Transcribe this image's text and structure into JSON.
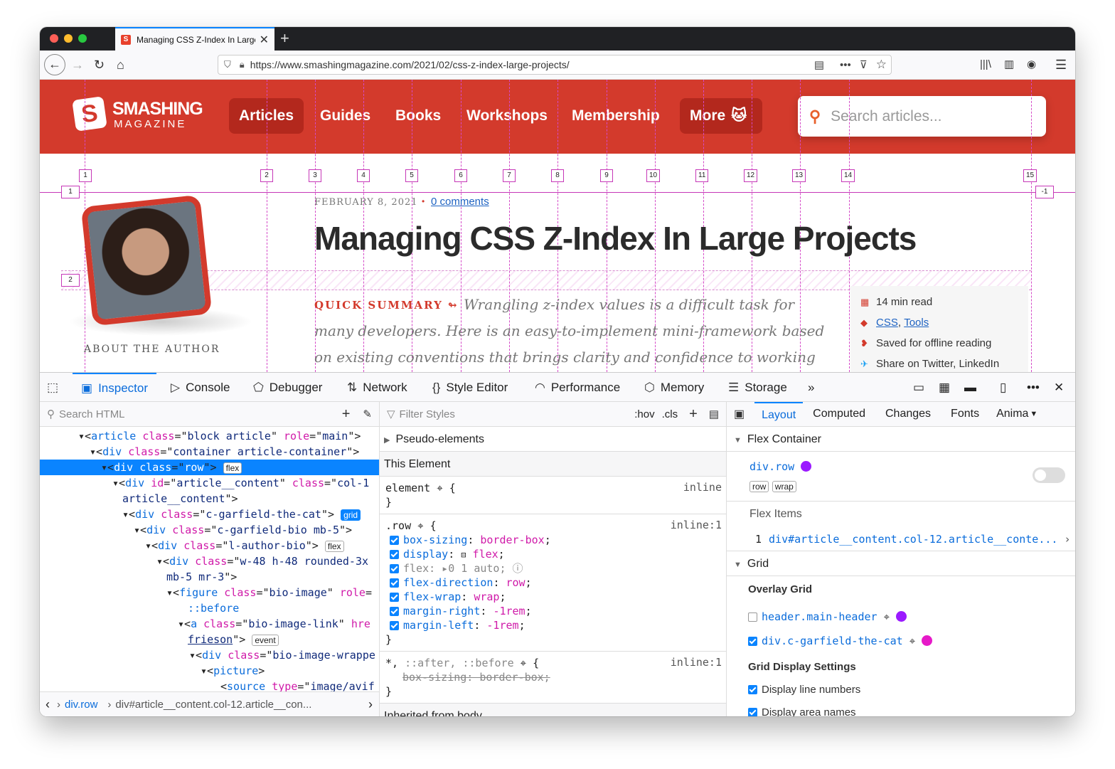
{
  "browser": {
    "tab_title": "Managing CSS Z-Index In Large Projects",
    "url": "https://www.smashingmagazine.com/2021/02/css-z-index-large-projects/"
  },
  "site": {
    "logo_title": "SMASHING",
    "logo_sub": "MAGAZINE",
    "nav": [
      "Articles",
      "Guides",
      "Books",
      "Workshops",
      "Membership",
      "More"
    ],
    "search_placeholder": "Search articles..."
  },
  "grid_overlay": {
    "columns": [
      "1",
      "2",
      "3",
      "4",
      "5",
      "6",
      "7",
      "8",
      "9",
      "10",
      "11",
      "12",
      "13",
      "14",
      "15"
    ],
    "rows": [
      "1",
      "-1",
      "2"
    ]
  },
  "article": {
    "date": "FEBRUARY 8, 2021",
    "comments": "0 comments",
    "title": "Managing CSS Z-Index In Large Projects",
    "summary_label": "QUICK SUMMARY ↬",
    "summary": "Wrangling z-index values is a difficult task for many developers. Here is an easy-to-implement mini-framework based on existing conventions that brings clarity and confidence to working with z-index.",
    "about": "ABOUT THE AUTHOR",
    "meta_read": "14 min read",
    "meta_tag1": "CSS",
    "meta_tag2": "Tools",
    "meta_saved": "Saved for offline reading",
    "meta_share": "Share on Twitter, LinkedIn"
  },
  "devtools": {
    "tabs": [
      "Inspector",
      "Console",
      "Debugger",
      "Network",
      "Style Editor",
      "Performance",
      "Memory",
      "Storage"
    ],
    "search_html": "Search HTML",
    "filter_styles": "Filter Styles",
    "hov": ":hov",
    "cls": ".cls",
    "layout_tabs": [
      "Layout",
      "Computed",
      "Changes",
      "Fonts",
      "Anima"
    ],
    "breadcrumbs": [
      "div.row",
      "div#article__content.col-12.article__con..."
    ],
    "pseudo": "Pseudo-elements",
    "this_element": "This Element",
    "inherited": "Inherited from body",
    "flex_container": "Flex Container",
    "flex_el": "div.row",
    "flex_badges": [
      "row",
      "wrap"
    ],
    "flex_items": "Flex Items",
    "flex_item_num": "1",
    "flex_item": "div#article__content.col-12.article__conte...",
    "grid": "Grid",
    "overlay_grid": "Overlay Grid",
    "overlay_items": [
      "header.main-header",
      "div.c-garfield-the-cat"
    ],
    "grid_settings": "Grid Display Settings",
    "display_line_numbers": "Display line numbers",
    "display_area_names": "Display area names",
    "colors": {
      "accent": "#0a84ff",
      "brand": "#d33a2c",
      "purple": "#9b1aff",
      "magenta": "#e619c8"
    }
  }
}
